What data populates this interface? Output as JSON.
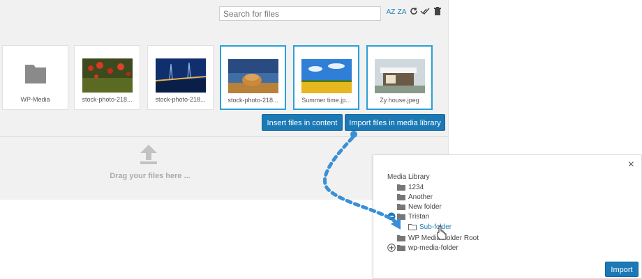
{
  "search": {
    "placeholder": "Search for files"
  },
  "toolbar": {
    "icons": [
      "sort-az-icon",
      "sort-za-icon",
      "refresh-icon",
      "select-all-icon",
      "trash-icon"
    ],
    "sort_az_label": "AZ",
    "sort_za_label": "ZA"
  },
  "files": [
    {
      "name": "WP-Media",
      "type": "folder",
      "selected": false
    },
    {
      "name": "stock-photo-218...",
      "type": "image",
      "selected": false
    },
    {
      "name": "stock-photo-218...",
      "type": "image",
      "selected": false
    },
    {
      "name": "stock-photo-218...",
      "type": "image",
      "selected": true
    },
    {
      "name": "Summer time.jp...",
      "type": "image",
      "selected": true
    },
    {
      "name": "Zy house.jpeg",
      "type": "image",
      "selected": true
    }
  ],
  "buttons": {
    "insert": "Insert files in content",
    "import_library": "Import files in media library"
  },
  "dropzone": {
    "text": "Drag your files here ..."
  },
  "dialog": {
    "close": "×",
    "title": "Media Library",
    "folders": [
      {
        "label": "1234"
      },
      {
        "label": "Another"
      },
      {
        "label": "New folder"
      },
      {
        "label": "Tristan",
        "expanded": true
      },
      {
        "label": "Sub-folder",
        "active": true
      },
      {
        "label": "WP Media Folder Root"
      },
      {
        "label": "wp-media-folder",
        "collapsed": true
      }
    ],
    "import_label": "Import"
  },
  "colors": {
    "accent": "#1b79b6",
    "selection": "#2aa0d6",
    "annotation": "#3b8fd6"
  }
}
